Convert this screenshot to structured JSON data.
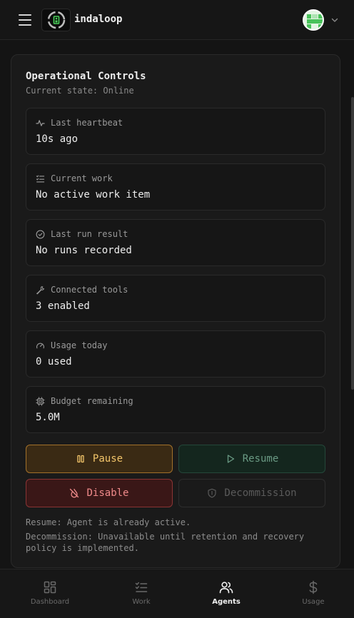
{
  "header": {
    "brand": "indaloop",
    "menu_icon": "hamburger-icon",
    "avatar_icon": "user-avatar",
    "chevron_icon": "chevron-down-icon"
  },
  "card": {
    "title": "Operational Controls",
    "subtitle": "Current state: Online",
    "stats": [
      {
        "icon": "activity-icon",
        "label": "Last heartbeat",
        "value": "10s ago"
      },
      {
        "icon": "list-checks-icon",
        "label": "Current work",
        "value": "No active work item"
      },
      {
        "icon": "check-circle-icon",
        "label": "Last run result",
        "value": "No runs recorded"
      },
      {
        "icon": "wrench-icon",
        "label": "Connected tools",
        "value": "3 enabled"
      },
      {
        "icon": "gauge-icon",
        "label": "Usage today",
        "value": "0 used"
      },
      {
        "icon": "chip-icon",
        "label": "Budget remaining",
        "value": "5.0M"
      }
    ],
    "buttons": {
      "pause": "Pause",
      "resume": "Resume",
      "disable": "Disable",
      "decommission": "Decommission"
    },
    "notes": {
      "resume": "Resume: Agent is already active.",
      "decommission": "Decommission: Unavailable until retention and recovery policy is implemented."
    }
  },
  "bottom_nav": [
    {
      "label": "Dashboard",
      "icon": "dashboard-icon",
      "active": false
    },
    {
      "label": "Work",
      "icon": "list-checks-icon",
      "active": false
    },
    {
      "label": "Agents",
      "icon": "users-icon",
      "active": true
    },
    {
      "label": "Usage",
      "icon": "dollar-icon",
      "active": false
    }
  ],
  "colors": {
    "pause": "#f3c56a",
    "resume": "#6a9a84",
    "disable": "#f08a8a",
    "decommission": "#5a5a5a"
  }
}
